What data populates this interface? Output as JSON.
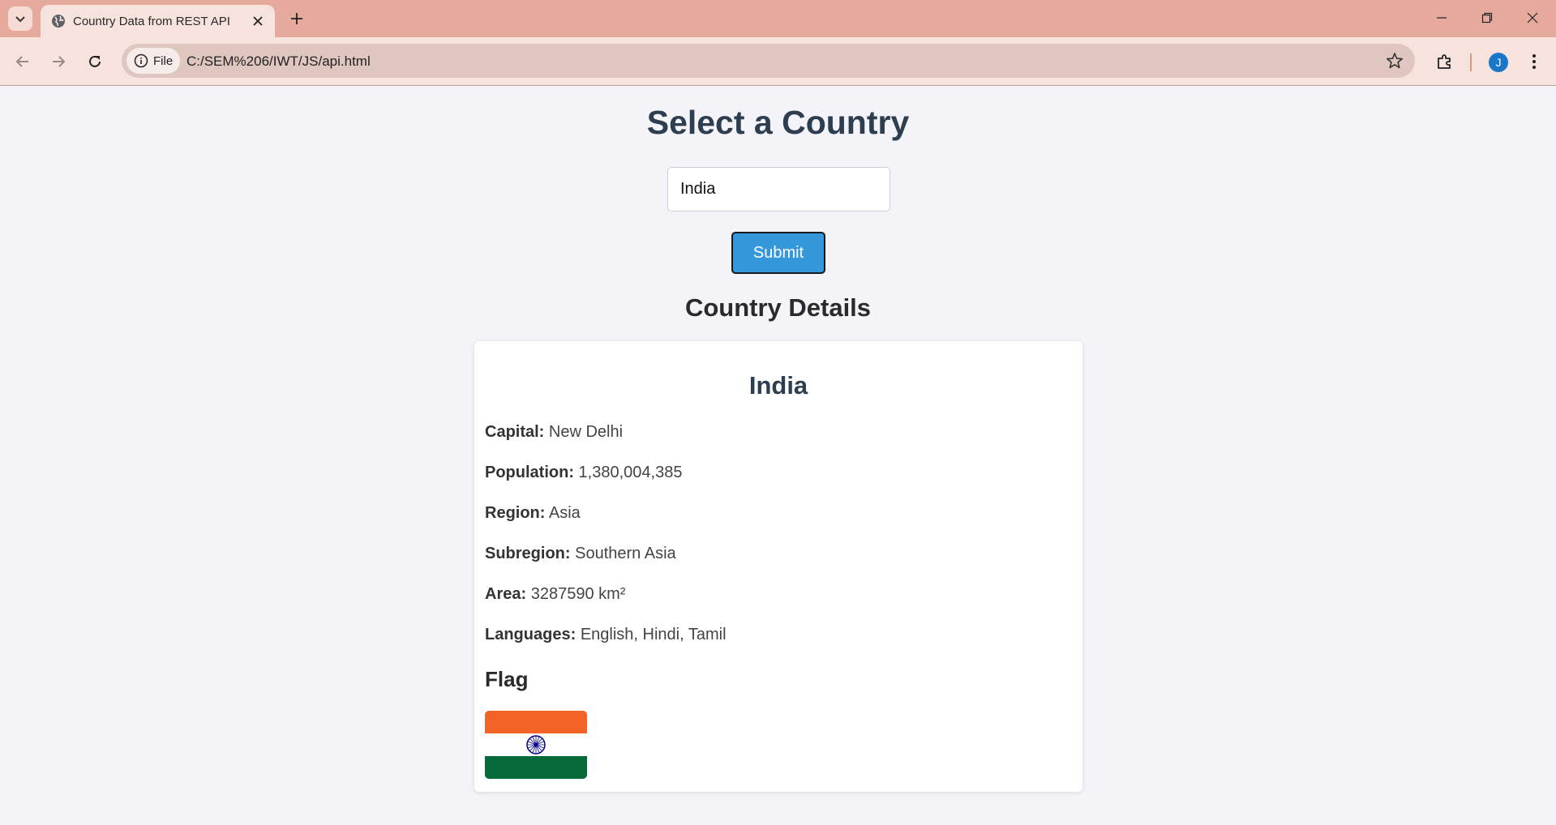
{
  "browser": {
    "tab_title": "Country Data from REST API",
    "site_chip_label": "File",
    "url": "C:/SEM%206/IWT/JS/api.html",
    "avatar_letter": "J"
  },
  "page": {
    "title": "Select a Country",
    "input_value": "India",
    "submit_label": "Submit",
    "details_title": "Country Details"
  },
  "country": {
    "name": "India",
    "fields": [
      {
        "label": "Capital:",
        "value": "New Delhi"
      },
      {
        "label": "Population:",
        "value": "1,380,004,385"
      },
      {
        "label": "Region:",
        "value": "Asia"
      },
      {
        "label": "Subregion:",
        "value": "Southern Asia"
      },
      {
        "label": "Area:",
        "value": "3287590 km²"
      },
      {
        "label": "Languages:",
        "value": "English, Hindi, Tamil"
      }
    ],
    "flag_title": "Flag"
  },
  "colors": {
    "heading": "#2c3e50",
    "button": "#3498db",
    "tabbar": "#e5aa9b",
    "flag_saffron": "#f26327",
    "flag_green": "#046a38",
    "flag_chakra": "#06038d"
  },
  "icons": [
    "tab-search-icon",
    "globe-icon",
    "close-icon",
    "plus-icon",
    "minimize-icon",
    "restore-icon",
    "window-close-icon",
    "back-icon",
    "forward-icon",
    "reload-icon",
    "info-icon",
    "star-icon",
    "extensions-icon",
    "menu-icon"
  ]
}
